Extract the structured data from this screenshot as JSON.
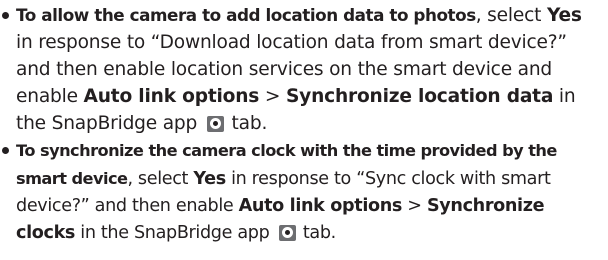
{
  "items": [
    {
      "lead": "To allow the camera to add location data to photos",
      "t1": ", select ",
      "b1": "Yes",
      "t2": " in response to “Download location data from smart device?” and then enable location services on the smart device and enable ",
      "b2": "Auto link options",
      "t3": " > ",
      "b3": "Synchronize location data",
      "t4": " in the SnapBridge app ",
      "icon": "camera-tab-icon",
      "t5": " tab."
    },
    {
      "lead": "To synchronize the camera clock with the time provided by the smart device",
      "t1": ", select ",
      "b1": "Yes",
      "t2": " in response to “Sync clock with smart device?” and then enable ",
      "b2": "Auto link options",
      "t3": " > ",
      "b3": "Synchronize clocks",
      "t4": " in the SnapBridge app ",
      "icon": "camera-tab-icon",
      "t5": " tab."
    }
  ]
}
